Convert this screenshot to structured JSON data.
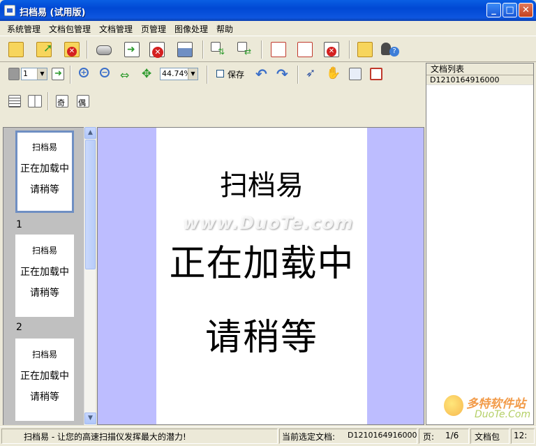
{
  "window": {
    "title": "扫档易 (试用版)",
    "minimize_glyph": "_",
    "maximize_glyph": "□",
    "close_glyph": "✕"
  },
  "menu": [
    "系统管理",
    "文档包管理",
    "文档管理",
    "页管理",
    "图像处理",
    "帮助"
  ],
  "toolbar2": {
    "page_select": "1",
    "zoom_select": "44.74%",
    "save_label": "保存",
    "odd_label": "奇",
    "even_label": "偶"
  },
  "thumbnails": [
    {
      "number": "",
      "line1": "扫档易",
      "line2": "正在加载中",
      "line3": "请稍等",
      "selected": true
    },
    {
      "number": "1",
      "line1": "扫档易",
      "line2": "正在加载中",
      "line3": "请稍等",
      "selected": false
    },
    {
      "number": "2",
      "line1": "扫档易",
      "line2": "正在加载中",
      "line3": "请稍等",
      "selected": false
    }
  ],
  "viewer": {
    "title": "扫档易",
    "loading": "正在加载中",
    "wait": "请稍等",
    "watermark": "www.DuoTe.com"
  },
  "doc_list": {
    "header": "文档列表",
    "items": [
      "D1210164916000"
    ]
  },
  "status": {
    "slogan": "扫档易 - 让您的高速扫描仪发挥最大的潜力!",
    "current_doc_label": "当前选定文档:",
    "current_doc_value": "D1210164916000",
    "page_label": "页:",
    "page_value": "1/6",
    "package_label": "文档包",
    "time_value": "12:"
  },
  "corner_logo": {
    "brand": "多特软件站",
    "url": "DuoTe.Com"
  },
  "colors": {
    "titlebar": "#0A5FE3",
    "viewer_bg": "#BDBDFF",
    "chrome": "#ECE9D8"
  }
}
